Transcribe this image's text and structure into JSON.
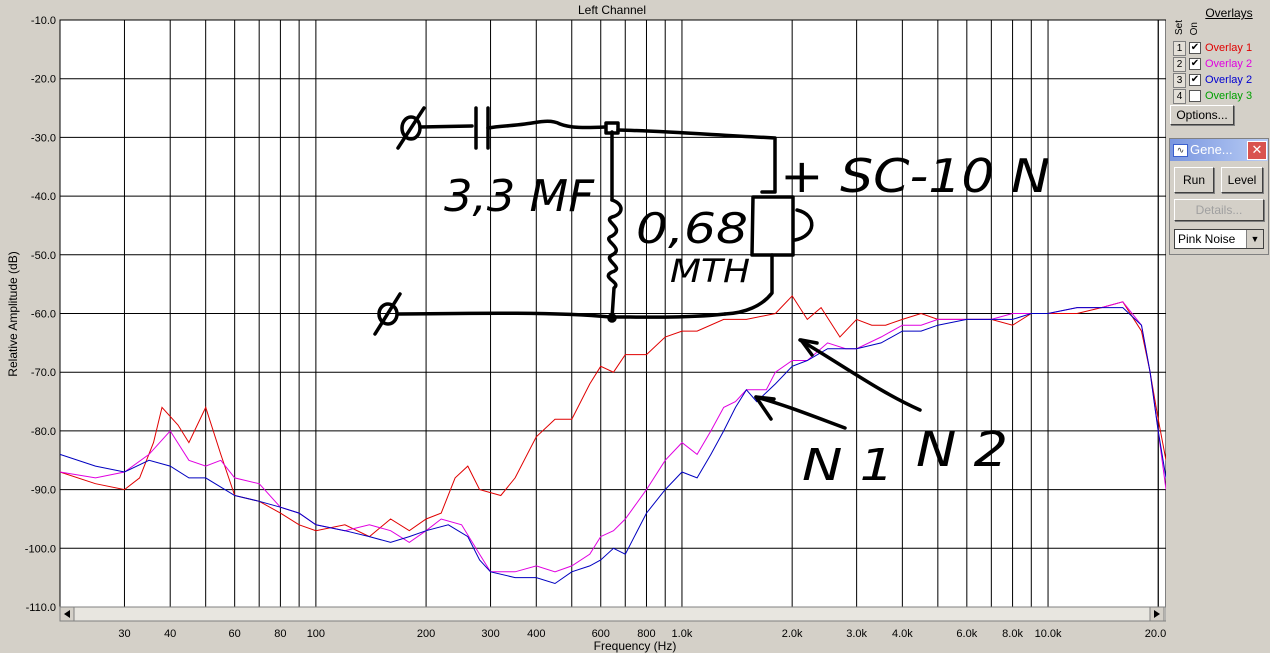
{
  "chart_data": {
    "type": "line",
    "title": "Left Channel",
    "xlabel": "Frequency (Hz)",
    "ylabel": "Relative Amplitude (dB)",
    "xscale": "log",
    "xlim": [
      20,
      21000
    ],
    "ylim": [
      -110,
      -10
    ],
    "grid": true,
    "y_ticks": [
      "-10.0",
      "-20.0",
      "-30.0",
      "-40.0",
      "-50.0",
      "-60.0",
      "-70.0",
      "-80.0",
      "-90.0",
      "-100.0",
      "-110.0"
    ],
    "x_ticks": [
      {
        "v": 30,
        "label": "30"
      },
      {
        "v": 40,
        "label": "40"
      },
      {
        "v": 60,
        "label": "60"
      },
      {
        "v": 80,
        "label": "80"
      },
      {
        "v": 100,
        "label": "100"
      },
      {
        "v": 200,
        "label": "200"
      },
      {
        "v": 300,
        "label": "300"
      },
      {
        "v": 400,
        "label": "400"
      },
      {
        "v": 600,
        "label": "600"
      },
      {
        "v": 800,
        "label": "800"
      },
      {
        "v": 1000,
        "label": "1.0k"
      },
      {
        "v": 2000,
        "label": "2.0k"
      },
      {
        "v": 3000,
        "label": "3.0k"
      },
      {
        "v": 4000,
        "label": "4.0k"
      },
      {
        "v": 6000,
        "label": "6.0k"
      },
      {
        "v": 8000,
        "label": "8.0k"
      },
      {
        "v": 10000,
        "label": "10.0k"
      },
      {
        "v": 20000,
        "label": "20.0k"
      }
    ],
    "series": [
      {
        "name": "Overlay 1",
        "color": "#e00000",
        "points": [
          [
            20,
            -87
          ],
          [
            25,
            -89
          ],
          [
            30,
            -90
          ],
          [
            33,
            -88
          ],
          [
            36,
            -82
          ],
          [
            38,
            -76
          ],
          [
            42,
            -79
          ],
          [
            45,
            -82
          ],
          [
            50,
            -76
          ],
          [
            55,
            -84
          ],
          [
            60,
            -91
          ],
          [
            70,
            -92
          ],
          [
            80,
            -94
          ],
          [
            90,
            -96
          ],
          [
            100,
            -97
          ],
          [
            120,
            -96
          ],
          [
            140,
            -98
          ],
          [
            160,
            -95
          ],
          [
            180,
            -97
          ],
          [
            200,
            -95
          ],
          [
            220,
            -94
          ],
          [
            240,
            -88
          ],
          [
            260,
            -86
          ],
          [
            280,
            -90
          ],
          [
            320,
            -91
          ],
          [
            350,
            -88
          ],
          [
            400,
            -81
          ],
          [
            450,
            -78
          ],
          [
            500,
            -78
          ],
          [
            560,
            -72
          ],
          [
            600,
            -69
          ],
          [
            650,
            -70
          ],
          [
            700,
            -67
          ],
          [
            800,
            -67
          ],
          [
            900,
            -64
          ],
          [
            1000,
            -63
          ],
          [
            1100,
            -63
          ],
          [
            1300,
            -61
          ],
          [
            1500,
            -61
          ],
          [
            1800,
            -60
          ],
          [
            2000,
            -57
          ],
          [
            2200,
            -61
          ],
          [
            2400,
            -59
          ],
          [
            2700,
            -64
          ],
          [
            3000,
            -61
          ],
          [
            3300,
            -62
          ],
          [
            3600,
            -62
          ],
          [
            4000,
            -61
          ],
          [
            4500,
            -60
          ],
          [
            5000,
            -61
          ],
          [
            6000,
            -61
          ],
          [
            7000,
            -61
          ],
          [
            8000,
            -62
          ],
          [
            9000,
            -60
          ],
          [
            10000,
            -60
          ],
          [
            12000,
            -60
          ],
          [
            14000,
            -59
          ],
          [
            16000,
            -58
          ],
          [
            18000,
            -63
          ],
          [
            19000,
            -70
          ],
          [
            20000,
            -78
          ],
          [
            21000,
            -85
          ]
        ]
      },
      {
        "name": "Overlay 2",
        "color": "#e000e0",
        "points": [
          [
            20,
            -87
          ],
          [
            25,
            -88
          ],
          [
            30,
            -87
          ],
          [
            35,
            -84
          ],
          [
            40,
            -80
          ],
          [
            45,
            -85
          ],
          [
            50,
            -86
          ],
          [
            55,
            -85
          ],
          [
            60,
            -88
          ],
          [
            70,
            -89
          ],
          [
            80,
            -93
          ],
          [
            90,
            -94
          ],
          [
            100,
            -96
          ],
          [
            120,
            -97
          ],
          [
            140,
            -96
          ],
          [
            160,
            -97
          ],
          [
            180,
            -99
          ],
          [
            200,
            -97
          ],
          [
            220,
            -95
          ],
          [
            250,
            -96
          ],
          [
            280,
            -101
          ],
          [
            300,
            -104
          ],
          [
            350,
            -104
          ],
          [
            400,
            -103
          ],
          [
            450,
            -104
          ],
          [
            500,
            -103
          ],
          [
            560,
            -101
          ],
          [
            600,
            -98
          ],
          [
            650,
            -97
          ],
          [
            700,
            -95
          ],
          [
            800,
            -90
          ],
          [
            900,
            -85
          ],
          [
            1000,
            -82
          ],
          [
            1100,
            -84
          ],
          [
            1200,
            -80
          ],
          [
            1300,
            -76
          ],
          [
            1400,
            -75
          ],
          [
            1500,
            -73
          ],
          [
            1700,
            -73
          ],
          [
            1800,
            -70
          ],
          [
            2000,
            -68
          ],
          [
            2200,
            -68
          ],
          [
            2500,
            -65
          ],
          [
            2800,
            -66
          ],
          [
            3000,
            -66
          ],
          [
            3500,
            -64
          ],
          [
            4000,
            -62
          ],
          [
            4500,
            -62
          ],
          [
            5000,
            -61
          ],
          [
            6000,
            -61
          ],
          [
            7000,
            -61
          ],
          [
            8000,
            -60
          ],
          [
            9000,
            -60
          ],
          [
            10000,
            -60
          ],
          [
            12000,
            -59
          ],
          [
            14000,
            -59
          ],
          [
            16000,
            -58
          ],
          [
            18000,
            -62
          ],
          [
            19000,
            -70
          ],
          [
            20000,
            -80
          ],
          [
            21000,
            -90
          ]
        ]
      },
      {
        "name": "Overlay 3",
        "color": "#0000c0",
        "points": [
          [
            20,
            -84
          ],
          [
            25,
            -86
          ],
          [
            30,
            -87
          ],
          [
            35,
            -85
          ],
          [
            40,
            -86
          ],
          [
            45,
            -88
          ],
          [
            50,
            -88
          ],
          [
            60,
            -91
          ],
          [
            70,
            -92
          ],
          [
            80,
            -93
          ],
          [
            90,
            -94
          ],
          [
            100,
            -96
          ],
          [
            120,
            -97
          ],
          [
            140,
            -98
          ],
          [
            160,
            -99
          ],
          [
            180,
            -98
          ],
          [
            200,
            -97
          ],
          [
            230,
            -96
          ],
          [
            260,
            -98
          ],
          [
            280,
            -102
          ],
          [
            300,
            -104
          ],
          [
            350,
            -105
          ],
          [
            400,
            -105
          ],
          [
            450,
            -106
          ],
          [
            500,
            -104
          ],
          [
            560,
            -103
          ],
          [
            600,
            -102
          ],
          [
            650,
            -100
          ],
          [
            700,
            -101
          ],
          [
            800,
            -94
          ],
          [
            900,
            -90
          ],
          [
            1000,
            -87
          ],
          [
            1100,
            -88
          ],
          [
            1200,
            -84
          ],
          [
            1300,
            -80
          ],
          [
            1400,
            -76
          ],
          [
            1500,
            -73
          ],
          [
            1600,
            -75
          ],
          [
            1800,
            -72
          ],
          [
            2000,
            -69
          ],
          [
            2200,
            -68
          ],
          [
            2500,
            -66
          ],
          [
            2800,
            -66
          ],
          [
            3000,
            -66
          ],
          [
            3500,
            -65
          ],
          [
            4000,
            -63
          ],
          [
            4500,
            -63
          ],
          [
            5000,
            -62
          ],
          [
            6000,
            -61
          ],
          [
            7000,
            -61
          ],
          [
            8000,
            -61
          ],
          [
            9000,
            -60
          ],
          [
            10000,
            -60
          ],
          [
            12000,
            -59
          ],
          [
            14000,
            -59
          ],
          [
            16000,
            -59
          ],
          [
            18000,
            -62
          ],
          [
            19000,
            -70
          ],
          [
            20000,
            -80
          ],
          [
            21000,
            -88
          ]
        ]
      }
    ]
  },
  "annotations": {
    "capacitor": "3,3 MF",
    "inductor_1": "0,68",
    "inductor_2": "MTH",
    "speaker": "+ SC-10 N",
    "n1": "N 1",
    "n2": "N 2"
  },
  "sidebar": {
    "title": "Overlays",
    "col_set": "Set",
    "col_on": "On",
    "overlays": [
      {
        "num": "1",
        "checked": true,
        "label": "Overlay 1",
        "color": "#e00000"
      },
      {
        "num": "2",
        "checked": true,
        "label": "Overlay 2",
        "color": "#e000e0"
      },
      {
        "num": "3",
        "checked": true,
        "label": "Overlay 2",
        "color": "#0000d0"
      },
      {
        "num": "4",
        "checked": false,
        "label": "Overlay 3",
        "color": "#00a000"
      }
    ],
    "options_label": "Options..."
  },
  "generator": {
    "title": "Gene...",
    "run_label": "Run",
    "level_label": "Level",
    "details_label": "Details...",
    "noise_value": "Pink Noise"
  }
}
